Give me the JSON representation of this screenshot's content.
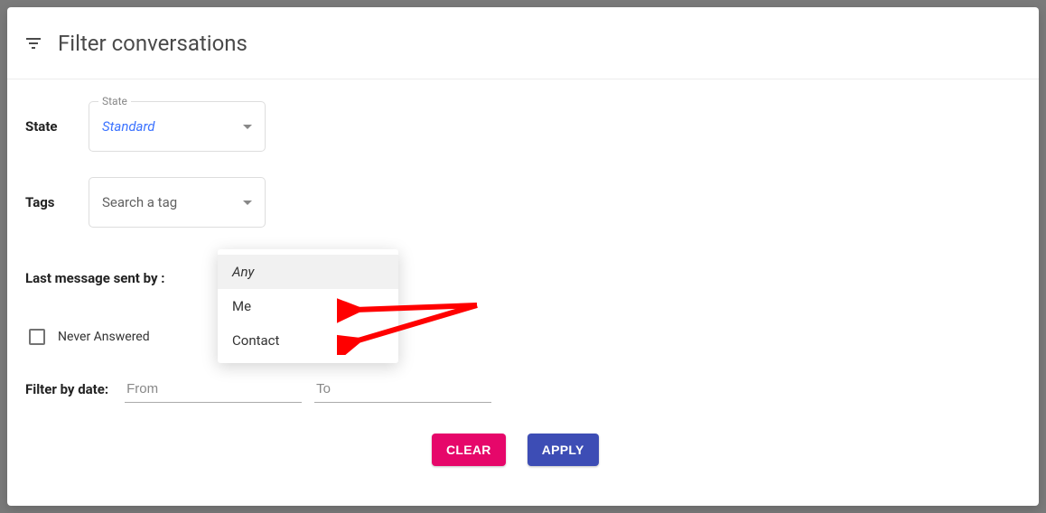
{
  "header": {
    "title": "Filter conversations"
  },
  "state": {
    "label": "State",
    "field_label": "State",
    "value": "Standard"
  },
  "tags": {
    "label": "Tags",
    "placeholder": "Search a tag"
  },
  "last_message": {
    "label": "Last message sent by :",
    "options": [
      "Any",
      "Me",
      "Contact"
    ],
    "selected": "Any"
  },
  "never_answered": {
    "label": "Never Answered",
    "checked": false
  },
  "date": {
    "label": "Filter by date:",
    "from_placeholder": "From",
    "to_placeholder": "To"
  },
  "buttons": {
    "clear": "CLEAR",
    "apply": "APPLY"
  },
  "colors": {
    "accent_blue": "#3b72ff",
    "clear_btn": "#e6076a",
    "apply_btn": "#3d4db5",
    "annotation_red": "#ff0000"
  }
}
